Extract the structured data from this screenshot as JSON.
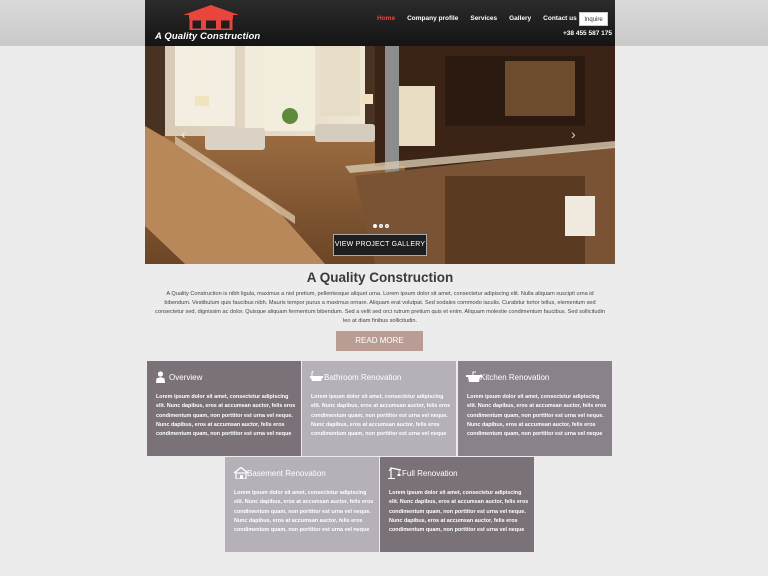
{
  "site": {
    "logo_text": "A Quality Construction",
    "brand_color": "#e8453c"
  },
  "nav": {
    "items": [
      {
        "label": "Home",
        "active": true
      },
      {
        "label": "Company profile",
        "active": false
      },
      {
        "label": "Services",
        "active": false
      },
      {
        "label": "Gallery",
        "active": false
      },
      {
        "label": "Contact us",
        "active": false
      }
    ],
    "inquire_label": "Inquire",
    "phone": "+38 455 587 175"
  },
  "hero": {
    "button_label": "VIEW PROJECT GALLERY",
    "slides": 3,
    "active_slide": 1
  },
  "intro": {
    "title": "A Quality Construction",
    "text": "A Quality Construction is nibh ligula, maximus a nisl pretium, pellentesque aliquet urna. Lorem ipsum dolor sit amet, consectetur adipiscing elit. Nulla aliquam suscipit urna id bibendum. Vestibulum quis faucibus nibh. Mauris tempor purus a maximus ornare. Aliquam erat volutpat. Sed sodales commodo iaculis. Curabitur tortor tellus, elementum sed consectetur sed, dignissim ac dolor. Quisque aliquam fermentum bibendum. Sed a velit sed orci rutrum pretium quis et enim. Aliquam molestie condimentum faucibus. Sed sollicitudin leo at diam finibus sollicitudin.",
    "read_more_label": "READ MORE"
  },
  "services": [
    {
      "title": "Overview",
      "icon": "person-icon",
      "text": "Lorem ipsum dolor sit amet, consectetur adipiscing elit. Nunc dapibus, eros at accumsan auctor, felis eros condimentum quam, non porttitor est urna vel neque. Nunc dapibus, eros at accumsan auctor, felis eros condimentum quam, non porttitor est urna vel neque"
    },
    {
      "title": "Bathroom Renovation",
      "icon": "bathtub-icon",
      "text": "Lorem ipsum dolor sit amet, consectetur adipiscing elit. Nunc dapibus, eros at accumsan auctor, felis eros condimentum quam, non porttitor est urna vel neque. Nunc dapibus, eros at accumsan auctor, felis eros condimentum quam, non porttitor est urna vel neque"
    },
    {
      "title": "Kitchen Renovation",
      "icon": "kitchen-sink-icon",
      "text": "Lorem ipsum dolor sit amet, consectetur adipiscing elit. Nunc dapibus, eros at accumsan auctor, felis eros condimentum quam, non porttitor est urna vel neque. Nunc dapibus, eros at accumsan auctor, felis eros condimentum quam, non porttitor est urna vel neque"
    },
    {
      "title": "Basement Renovation",
      "icon": "house-icon",
      "text": "Lorem ipsum dolor sit amet, consectetur adipiscing elit. Nunc dapibus, eros at accumsan auctor, felis eros condimentum quam, non porttitor est urna vel neque. Nunc dapibus, eros at accumsan auctor, felis eros condimentum quam, non porttitor est urna vel neque"
    },
    {
      "title": "Full Renovation",
      "icon": "crane-icon",
      "text": "Lorem ipsum dolor sit amet, consectetur adipiscing elit. Nunc dapibus, eros at accumsan auctor, felis eros condimentum quam, non porttitor est urna vel neque. Nunc dapibus, eros at accumsan auctor, felis eros condimentum quam, non porttitor est urna vel neque"
    }
  ]
}
